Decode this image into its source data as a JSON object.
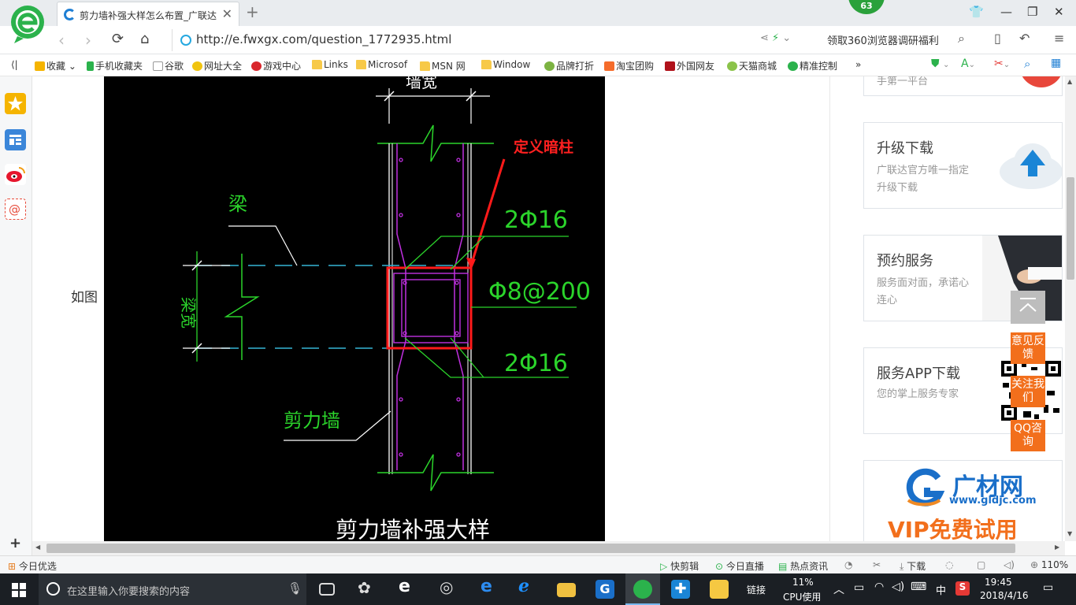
{
  "tab": {
    "title": "剪力墙补强大样怎么布置_广联达"
  },
  "badge": "63",
  "address": {
    "url": "http://e.fwxgx.com/question_1772935.html",
    "promo": "领取360浏览器调研福利"
  },
  "bookmarks": [
    "收藏",
    "手机收藏夹",
    "谷歌",
    "网址大全",
    "游戏中心",
    "Links",
    "Microsof",
    "MSN 网",
    "Window",
    "品牌打折",
    "淘宝团购",
    "外国网友",
    "天猫商城",
    "精准控制"
  ],
  "content": {
    "label": "如图"
  },
  "drawing": {
    "label_wall_width": "墙宽",
    "label_define": "定义暗柱",
    "label_beam": "梁",
    "label_rebar_top": "2Φ16",
    "label_stirrup": "Φ8@200",
    "label_rebar_bottom": "2Φ16",
    "label_beam_width": "梁宽",
    "label_shear_wall": "剪力墙",
    "label_title": "剪力墙补强大样"
  },
  "cards": [
    {
      "title": "",
      "desc": "手第一平台"
    },
    {
      "title": "升级下载",
      "desc": "广联达官方唯一指定升级下载"
    },
    {
      "title": "预约服务",
      "desc": "服务面对面，承诺心连心"
    },
    {
      "title": "服务APP下载",
      "desc": "您的掌上服务专家"
    },
    {
      "title": "广材网",
      "sub": "www.gldjc.com",
      "vip": "VIP免费试用"
    }
  ],
  "float_buttons": [
    "意见反馈",
    "关注我们",
    "QQ咨询"
  ],
  "status": {
    "left": "今日优选",
    "items": [
      "快剪辑",
      "今日直播",
      "热点资讯",
      "下载"
    ],
    "zoom": "110%"
  },
  "taskbar": {
    "search_placeholder": "在这里输入你要搜索的内容",
    "link_label": "链接",
    "cpu_percent": "11%",
    "cpu_label": "CPU使用",
    "ime": "中",
    "time": "19:45",
    "date": "2018/4/16"
  },
  "colors": {
    "accent": "#1f7fd4",
    "orange": "#f26f1c",
    "cad_green": "#2bd42b",
    "cad_magenta": "#c030e0",
    "cad_red": "#ff1a1a"
  }
}
